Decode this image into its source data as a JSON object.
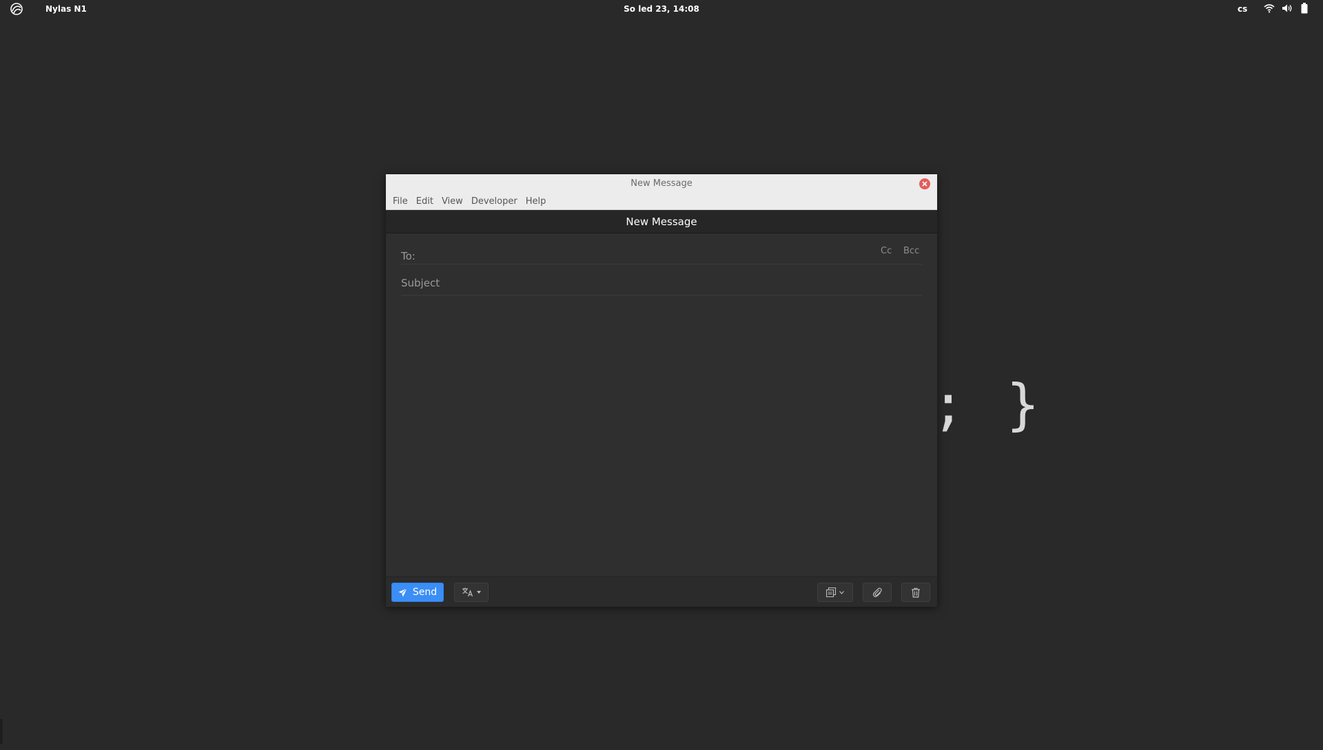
{
  "topbar": {
    "app_name": "Nylas N1",
    "clock": "So led 23, 14:08",
    "language": "cs"
  },
  "background": {
    "code_text": "; }"
  },
  "window": {
    "title": "New Message",
    "menu": [
      "File",
      "Edit",
      "View",
      "Developer",
      "Help"
    ]
  },
  "composer": {
    "header_title": "New Message",
    "to_label": "To:",
    "to_value": "",
    "cc_label": "Cc",
    "bcc_label": "Bcc",
    "subject_placeholder": "Subject",
    "subject_value": "",
    "body_value": ""
  },
  "footer": {
    "send_label": "Send"
  },
  "colors": {
    "accent": "#3b8ef5",
    "close": "#e35d5b",
    "desktop": "#292929"
  },
  "icons": {
    "logo": "app-logo-icon",
    "wifi": "wifi-icon",
    "volume": "volume-icon",
    "battery": "battery-icon",
    "close": "close-icon",
    "send": "paper-plane-icon",
    "translate": "translate-icon",
    "template": "template-icon",
    "attach": "paperclip-icon",
    "trash": "trash-icon"
  }
}
